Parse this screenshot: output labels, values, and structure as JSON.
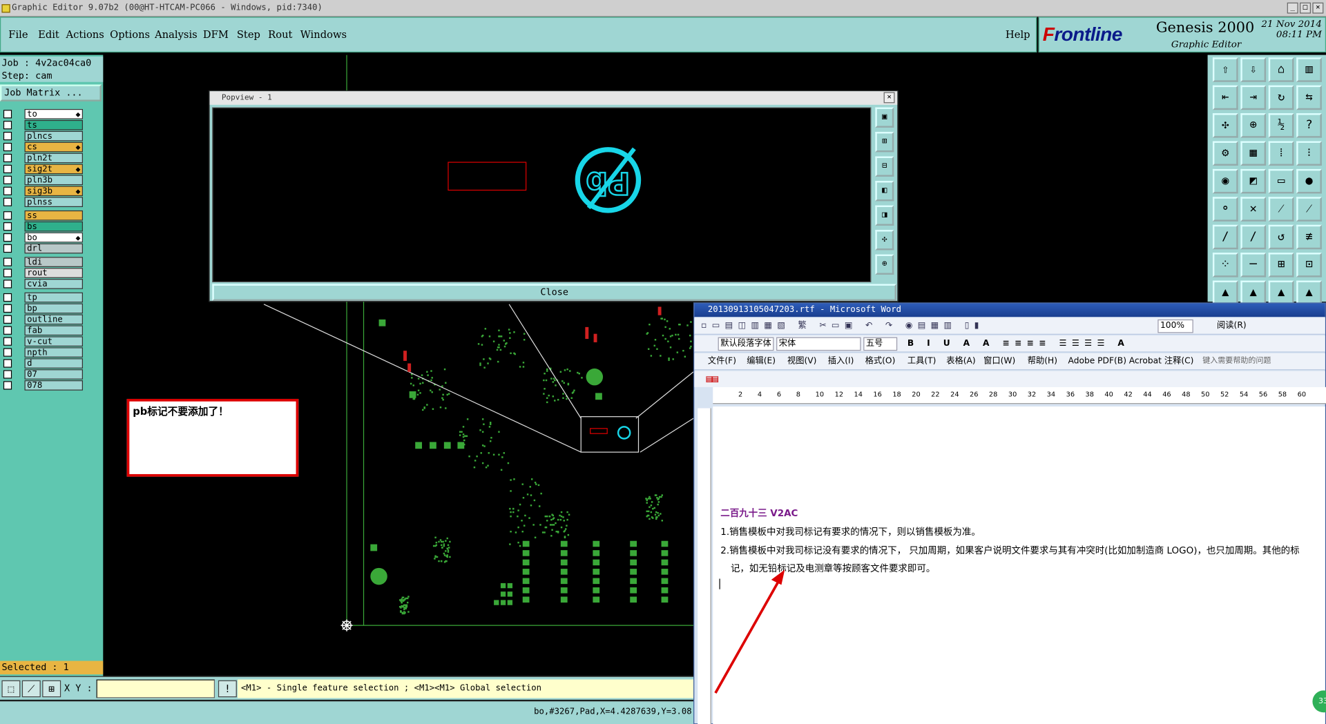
{
  "window": {
    "title": "Graphic Editor 9.07b2 (00@HT-HTCAM-PC066 - Windows, pid:7340)"
  },
  "menu": {
    "items": [
      "File",
      "Edit",
      "Actions",
      "Options",
      "Analysis",
      "DFM",
      "Step",
      "Rout",
      "Windows"
    ],
    "help": "Help"
  },
  "brand": {
    "logo_prefix": "F",
    "logo_rest": "rontline",
    "product": "Genesis 2000",
    "subtitle": "Graphic Editor",
    "date": "21 Nov 2014",
    "time": "08:11 PM"
  },
  "job": {
    "job_line": "Job : 4v2ac04ca0",
    "step_line": "Step: cam",
    "matrix_button": "Job Matrix ..."
  },
  "layers": [
    {
      "name": "to",
      "color": "#ffffff",
      "mark": "⬥"
    },
    {
      "name": "ts",
      "color": "#2fb08c",
      "mark": ""
    },
    {
      "name": "plncs",
      "color": "#9fd6d3",
      "mark": ""
    },
    {
      "name": "cs",
      "color": "#e8b543",
      "mark": "⬥"
    },
    {
      "name": "pln2t",
      "color": "#9fd6d3",
      "mark": ""
    },
    {
      "name": "sig2t",
      "color": "#e8b543",
      "mark": "⬥"
    },
    {
      "name": "pln3b",
      "color": "#9fd6d3",
      "mark": ""
    },
    {
      "name": "sig3b",
      "color": "#e8b543",
      "mark": "⬥"
    },
    {
      "name": "plnss",
      "color": "#9fd6d3",
      "mark": ""
    },
    {
      "name": "ss",
      "color": "#e8b543",
      "mark": ""
    },
    {
      "name": "bs",
      "color": "#2fb08c",
      "mark": ""
    },
    {
      "name": "bo",
      "color": "#ffffff",
      "mark": "⬥"
    },
    {
      "name": "drl",
      "color": "#b8c8c8",
      "mark": ""
    },
    {
      "name": "ldi",
      "color": "#b8c8c8",
      "mark": ""
    },
    {
      "name": "rout",
      "color": "#dddddd",
      "mark": ""
    },
    {
      "name": "cvia",
      "color": "#9fd6d3",
      "mark": ""
    },
    {
      "name": "tp",
      "color": "#9fd6d3",
      "mark": ""
    },
    {
      "name": "bp",
      "color": "#9fd6d3",
      "mark": ""
    },
    {
      "name": "outline",
      "color": "#9fd6d3",
      "mark": ""
    },
    {
      "name": "fab",
      "color": "#9fd6d3",
      "mark": ""
    },
    {
      "name": "v-cut",
      "color": "#9fd6d3",
      "mark": ""
    },
    {
      "name": "npth",
      "color": "#9fd6d3",
      "mark": ""
    },
    {
      "name": "d",
      "color": "#9fd6d3",
      "mark": ""
    },
    {
      "name": "07",
      "color": "#9fd6d3",
      "mark": ""
    },
    {
      "name": "078",
      "color": "#9fd6d3",
      "mark": ""
    }
  ],
  "selected": "Selected : 1",
  "bottom": {
    "xy_label": "X Y :",
    "xy_value": "",
    "hint": "<M1> - Single feature selection ; <M1><M1> Global selection",
    "status": "bo,#3267,Pad,X=4.4287639,Y=3.08"
  },
  "popview": {
    "title": "Popview - 1",
    "close_label": "Close"
  },
  "note": {
    "text": "pb标记不要添加了！"
  },
  "word": {
    "title": "20130913105047203.rtf - Microsoft Word",
    "style_box": "默认段落字体",
    "font_box": "宋体",
    "size_box": "五号",
    "zoom": "100%",
    "read_label": "阅读(R)",
    "menus": [
      "文件(F)",
      "编辑(E)",
      "视图(V)",
      "插入(I)",
      "格式(O)",
      "工具(T)",
      "表格(A)",
      "窗口(W)",
      "帮助(H)",
      "Adobe PDF(B)",
      "Acrobat 注释(C)"
    ],
    "help_placeholder": "键入需要帮助的问题",
    "ruler_marks": [
      "2",
      "4",
      "6",
      "8",
      "10",
      "12",
      "14",
      "16",
      "18",
      "20",
      "22",
      "24",
      "26",
      "28",
      "30",
      "32",
      "34",
      "36",
      "38",
      "40",
      "42",
      "44",
      "46",
      "48",
      "50",
      "52",
      "54",
      "56",
      "58",
      "60"
    ],
    "heading": "二百九十三 V2AC",
    "line1": "1.销售模板中对我司标记有要求的情况下，则以销售模板为准。",
    "line2a": "2.销售模板中对我司标记没有要求的情况下， 只加周期，如果客户说明文件要求与其有冲突时(比如加制造商 LOGO)，也只加周期。其他的标",
    "line2b": "记，如无铅标记及电测章等按顾客文件要求即可。"
  },
  "colors": {
    "panel": "#9fd6d3",
    "left": "#5fc7b0",
    "pad": "#3aa838",
    "popview_symbol": "#18d6e8",
    "annotation": "#d00000"
  }
}
